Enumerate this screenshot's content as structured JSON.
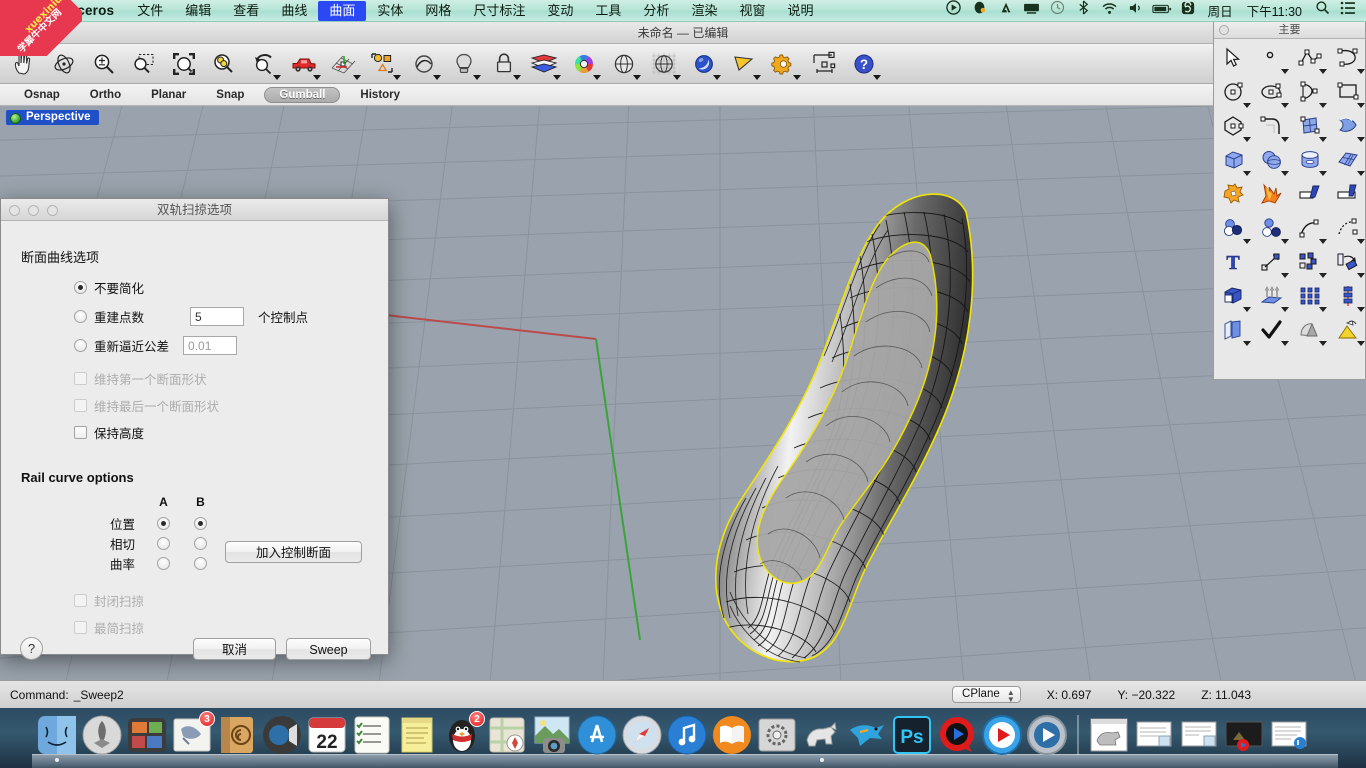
{
  "menubar": {
    "apple_icon": "apple-logo",
    "app_name": "Rhinoceros",
    "items": [
      {
        "label": "文件",
        "active": false
      },
      {
        "label": "编辑",
        "active": false
      },
      {
        "label": "查看",
        "active": false
      },
      {
        "label": "曲线",
        "active": false
      },
      {
        "label": "曲面",
        "active": true
      },
      {
        "label": "实体",
        "active": false
      },
      {
        "label": "网格",
        "active": false
      },
      {
        "label": "尺寸标注",
        "active": false
      },
      {
        "label": "变动",
        "active": false
      },
      {
        "label": "工具",
        "active": false
      },
      {
        "label": "分析",
        "active": false
      },
      {
        "label": "渲染",
        "active": false
      },
      {
        "label": "视窗",
        "active": false
      },
      {
        "label": "说明",
        "active": false
      }
    ],
    "status_icons": [
      "record-icon",
      "qq-penguin-icon",
      "adobe-icon",
      "display-icon",
      "timemachine-icon",
      "bluetooth-icon",
      "wifi-icon",
      "volume-icon",
      "battery-icon",
      "sogou-input-icon"
    ],
    "day": "周日",
    "time": "下午11:30",
    "search_icon": "search-icon",
    "notification_icon": "notification-center-icon"
  },
  "watermark": {
    "line1": "xuexiniu",
    "line2": "学犀牛中文网",
    "color": "#e8384f"
  },
  "window": {
    "title": "未命名 — 已编辑"
  },
  "main_toolbar": {
    "buttons": [
      {
        "name": "pan-icon"
      },
      {
        "name": "rotate-view-icon"
      },
      {
        "name": "zoom-in-out-icon"
      },
      {
        "name": "zoom-window-icon"
      },
      {
        "name": "zoom-extents-icon"
      },
      {
        "name": "zoom-selected-icon"
      },
      {
        "name": "undo-view-icon"
      },
      {
        "name": "named-views-car-icon"
      },
      {
        "name": "grid-snap-icon"
      },
      {
        "name": "select-objects-icon"
      },
      {
        "name": "select-curve-icon"
      },
      {
        "name": "light-icon"
      },
      {
        "name": "lock-icon"
      },
      {
        "name": "layers-icon"
      },
      {
        "name": "color-wheel-icon"
      },
      {
        "name": "shade-icon"
      },
      {
        "name": "render-preview-icon"
      },
      {
        "name": "render-icon"
      },
      {
        "name": "background-bitmap-icon"
      },
      {
        "name": "options-gear-icon"
      },
      {
        "name": "dimension-icon"
      },
      {
        "name": "help-icon"
      }
    ]
  },
  "toggles": [
    {
      "label": "Osnap",
      "on": false
    },
    {
      "label": "Ortho",
      "on": false
    },
    {
      "label": "Planar",
      "on": false
    },
    {
      "label": "Snap",
      "on": false
    },
    {
      "label": "Gumball",
      "on": true
    },
    {
      "label": "History",
      "on": false
    }
  ],
  "viewport": {
    "label": "Perspective",
    "background_color": "#9aa3ad",
    "grid_color": "#8c949e",
    "x_axis_color": "#b44b4b",
    "y_axis_color": "#3aa43a",
    "surface_edge_color": "#f2e600",
    "isocurve_color": "#111111"
  },
  "palette": {
    "title": "主要",
    "close_icon": "close-icon",
    "icons": [
      "select-arrow-icon",
      "point-icon",
      "polyline-icon",
      "curve-interp-icon",
      "circle-icon",
      "ellipse-icon",
      "arc-icon",
      "rectangle-icon",
      "polygon-icon",
      "fillet-curve-icon",
      "surface-from-curves-icon",
      "sweep1-icon",
      "box-icon",
      "sphere-icon",
      "cylinder-icon",
      "surface-grid-icon",
      "boolean-union-icon",
      "explode-icon",
      "trim-icon",
      "split-icon",
      "offset-surface-icon",
      "offset-curve-icon",
      "blend-curve-icon",
      "fillet-surface-icon",
      "text-icon",
      "move-icon",
      "copy-icon",
      "rotate-icon",
      "scale-icon",
      "extrude-icon",
      "array-icon",
      "mirror-icon",
      "cap-icon",
      "check-objects-icon",
      "mesh-from-surface-icon",
      "render-mesh-icon"
    ]
  },
  "dialog": {
    "title": "双轨扫掠选项",
    "window_controls": [
      "close-button",
      "minimize-button",
      "zoom-button"
    ],
    "section_cross_section": {
      "title": "断面曲线选项",
      "radio_group": [
        {
          "label": "不要简化",
          "selected": true
        },
        {
          "label": "重建点数",
          "selected": false,
          "value": "5",
          "unit": "个控制点"
        },
        {
          "label": "重新逼近公差",
          "selected": false,
          "value": "0.01"
        }
      ],
      "checkboxes": [
        {
          "label": "维持第一个断面形状",
          "checked": false,
          "disabled": true
        },
        {
          "label": "维持最后一个断面形状",
          "checked": false,
          "disabled": true
        },
        {
          "label": "保持高度",
          "checked": false,
          "disabled": false
        }
      ]
    },
    "section_rail": {
      "title": "Rail curve options",
      "columns": [
        "A",
        "B"
      ],
      "rows": [
        {
          "label": "位置",
          "a": true,
          "b": true
        },
        {
          "label": "相切",
          "a": false,
          "b": false
        },
        {
          "label": "曲率",
          "a": false,
          "b": false
        }
      ],
      "checkboxes": [
        {
          "label": "封闭扫掠",
          "checked": false,
          "disabled": true
        },
        {
          "label": "最简扫掠",
          "checked": false,
          "disabled": true
        }
      ],
      "add_section_button": "加入控制断面"
    },
    "help_button": "?",
    "cancel_button": "取消",
    "confirm_button": "Sweep"
  },
  "statusbar": {
    "command_label": "Command:",
    "command_value": "_Sweep2",
    "cplane": "CPlane",
    "x": "X: 0.697",
    "y": "Y: −20.322",
    "z": "Z: 11.043"
  },
  "dock": {
    "items": [
      {
        "name": "finder-icon",
        "badge": null
      },
      {
        "name": "launchpad-icon",
        "badge": null
      },
      {
        "name": "mission-control-icon",
        "badge": null
      },
      {
        "name": "mail-icon",
        "badge": "3"
      },
      {
        "name": "contacts-icon",
        "badge": null
      },
      {
        "name": "facetime-icon",
        "badge": null
      },
      {
        "name": "calendar-icon",
        "badge": null
      },
      {
        "name": "reminders-icon",
        "badge": null
      },
      {
        "name": "notes-icon",
        "badge": null
      },
      {
        "name": "qq-icon",
        "badge": "2"
      },
      {
        "name": "maps-icon",
        "badge": null
      },
      {
        "name": "photos-icon",
        "badge": null
      },
      {
        "name": "app-store-icon",
        "badge": null
      },
      {
        "name": "safari-icon",
        "badge": null
      },
      {
        "name": "itunes-icon",
        "badge": null
      },
      {
        "name": "ibooks-icon",
        "badge": null
      },
      {
        "name": "system-preferences-icon",
        "badge": null
      },
      {
        "name": "rhinoceros-icon",
        "badge": null
      },
      {
        "name": "thunderbird-icon",
        "badge": null
      },
      {
        "name": "photoshop-icon",
        "badge": null
      },
      {
        "name": "quicktime-player-icon",
        "badge": null
      },
      {
        "name": "media-player-icon",
        "badge": null
      },
      {
        "name": "dvd-player-icon",
        "badge": null
      }
    ],
    "minimized": [
      {
        "name": "rhino-window-icon"
      },
      {
        "name": "document-window-icon"
      },
      {
        "name": "document-window-icon"
      },
      {
        "name": "video-window-icon"
      },
      {
        "name": "text-window-icon"
      }
    ],
    "trash_icon": "trash-icon",
    "calendar_day": "22"
  }
}
